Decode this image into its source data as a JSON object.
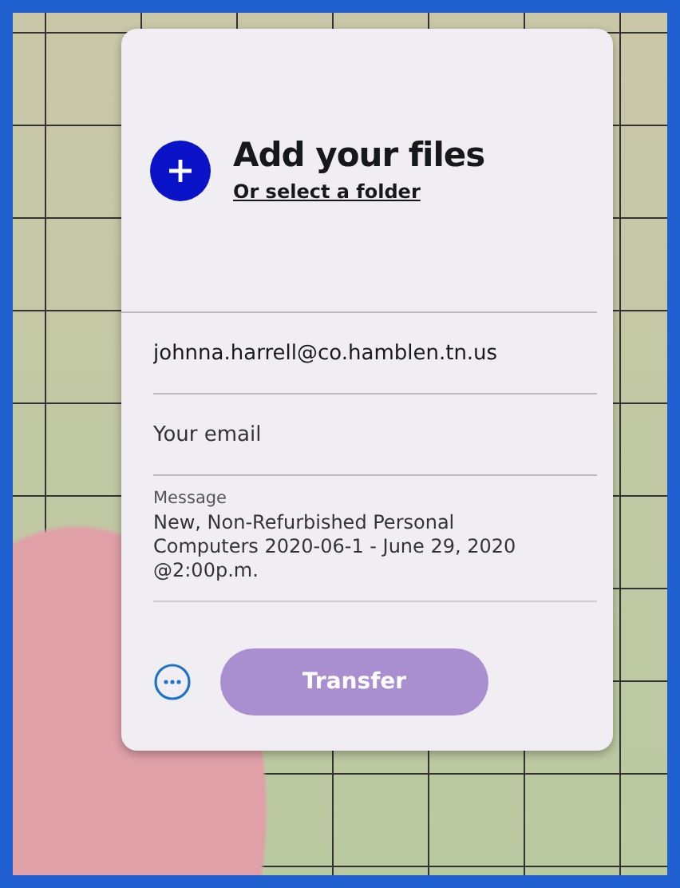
{
  "upload": {
    "title": "Add your files",
    "link": "Or select a folder"
  },
  "fields": [
    {
      "kind": "value",
      "value": "johnna.harrell@co.hamblen.tn.us"
    },
    {
      "kind": "placeholder",
      "placeholder": "Your email"
    }
  ],
  "message": {
    "label": "Message",
    "value": "New, Non-Refurbished Personal Computers 2020-06-1 - June 29, 2020 @2:00p.m."
  },
  "transfer_button": {
    "label": "Transfer",
    "disabled": true
  }
}
